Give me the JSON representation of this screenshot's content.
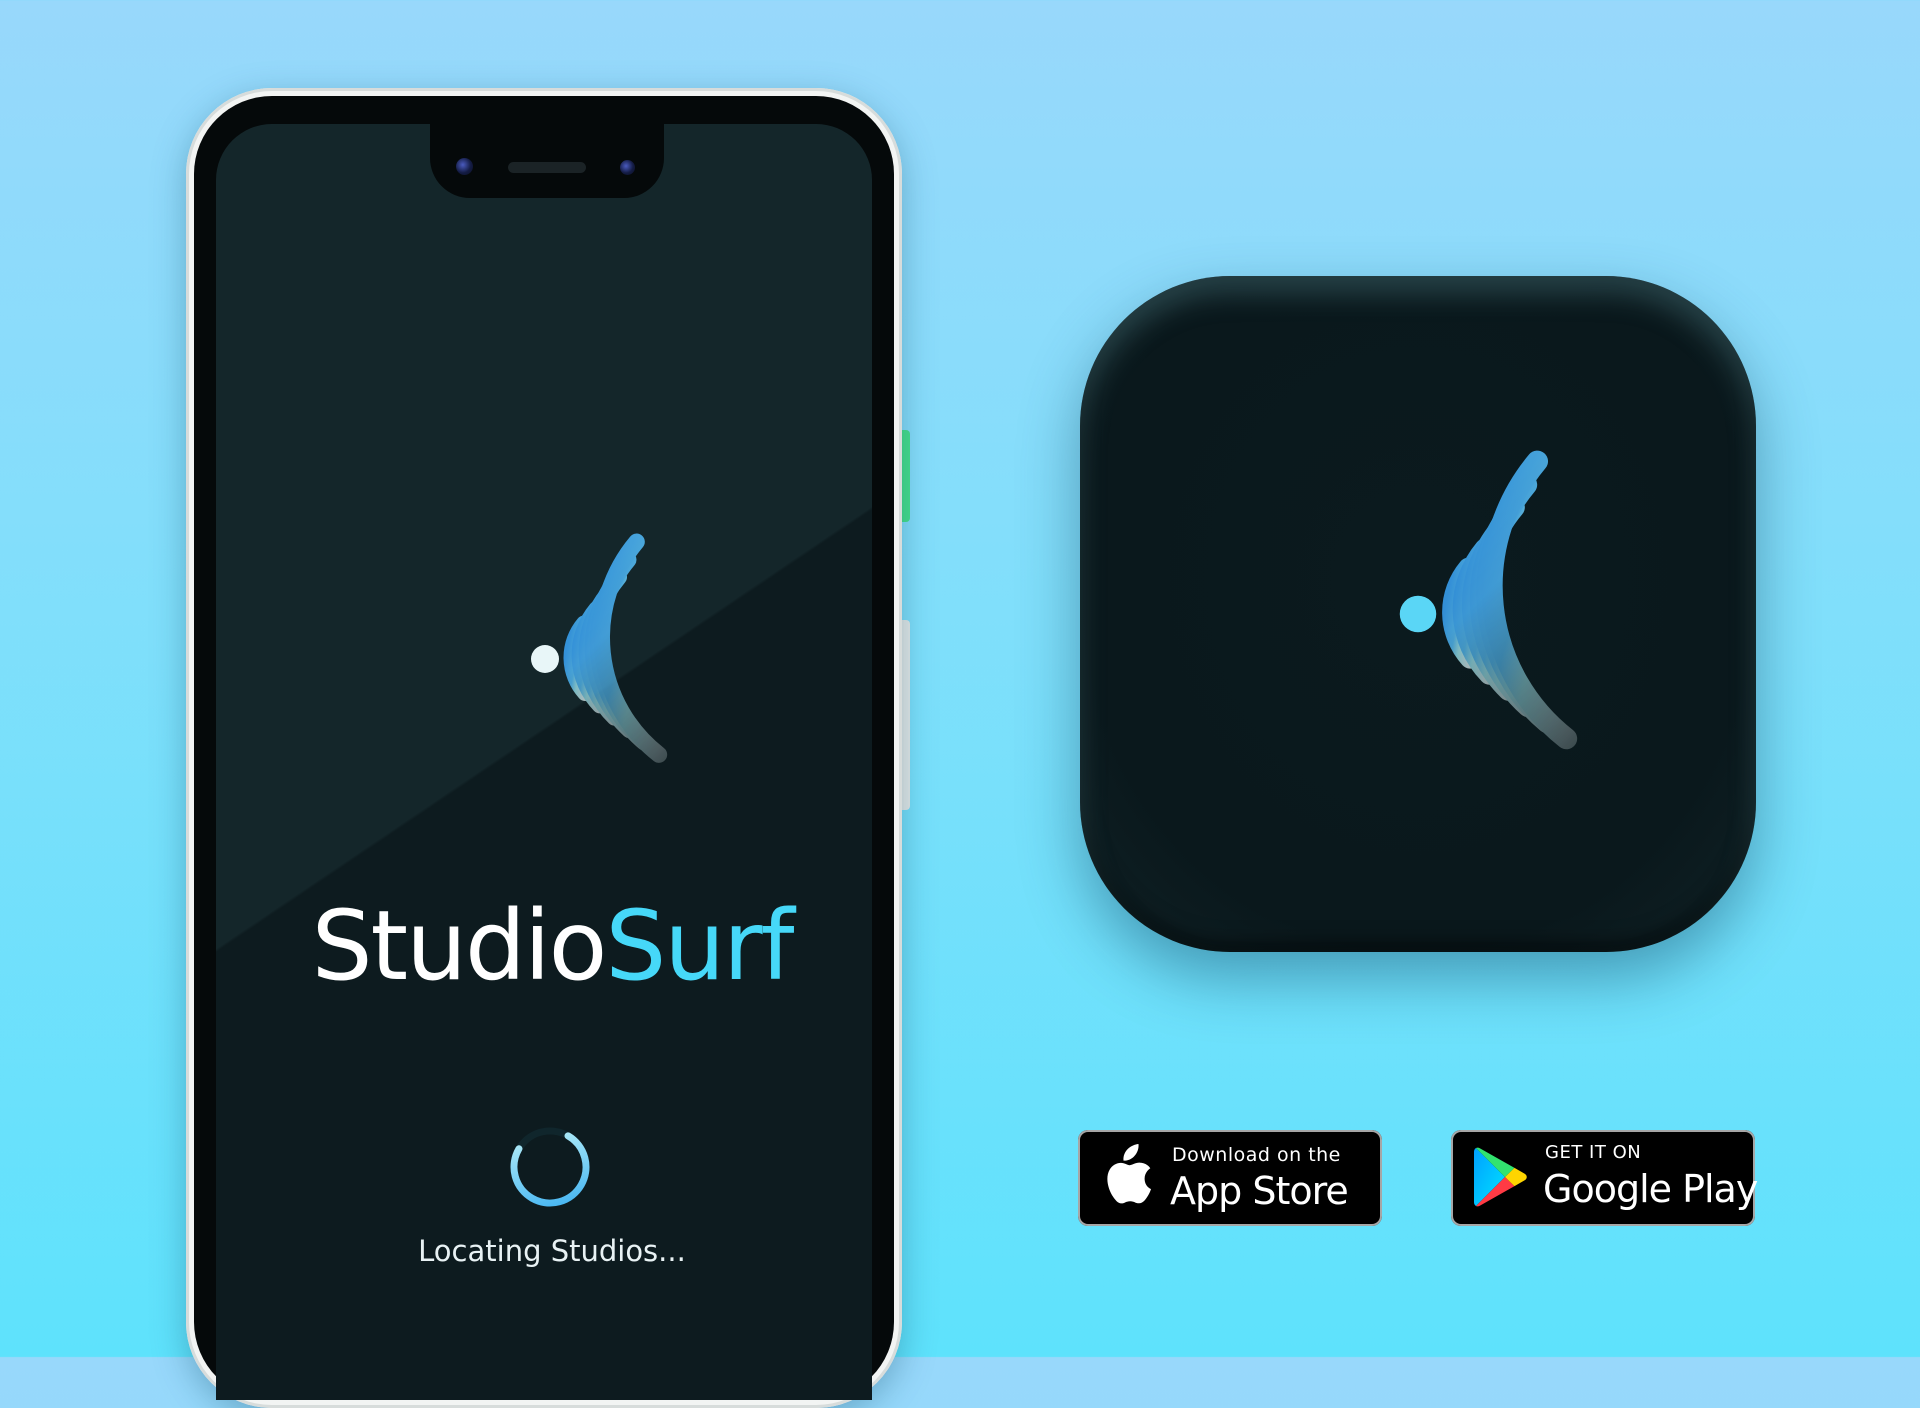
{
  "app": {
    "name_part1": "Studio",
    "name_part2": "Surf",
    "loading_text": "Locating Studios..."
  },
  "badges": {
    "app_store": {
      "small_text": "Download on the",
      "big_text": "App Store"
    },
    "google_play": {
      "small_text": "GET IT ON",
      "big_text": "Google Play"
    }
  },
  "icons": {
    "logo": "vinyl-disc-logo-icon",
    "spinner": "loading-spinner-icon",
    "apple": "apple-icon",
    "google_play": "google-play-icon"
  },
  "colors": {
    "background_top": "#98d8fb",
    "background_bottom": "#5ee2fc",
    "screen_background": "#14262a",
    "accent": "#46d8f8",
    "badge_background": "#000000"
  },
  "loading": {
    "spinner_progress": 0.75
  }
}
